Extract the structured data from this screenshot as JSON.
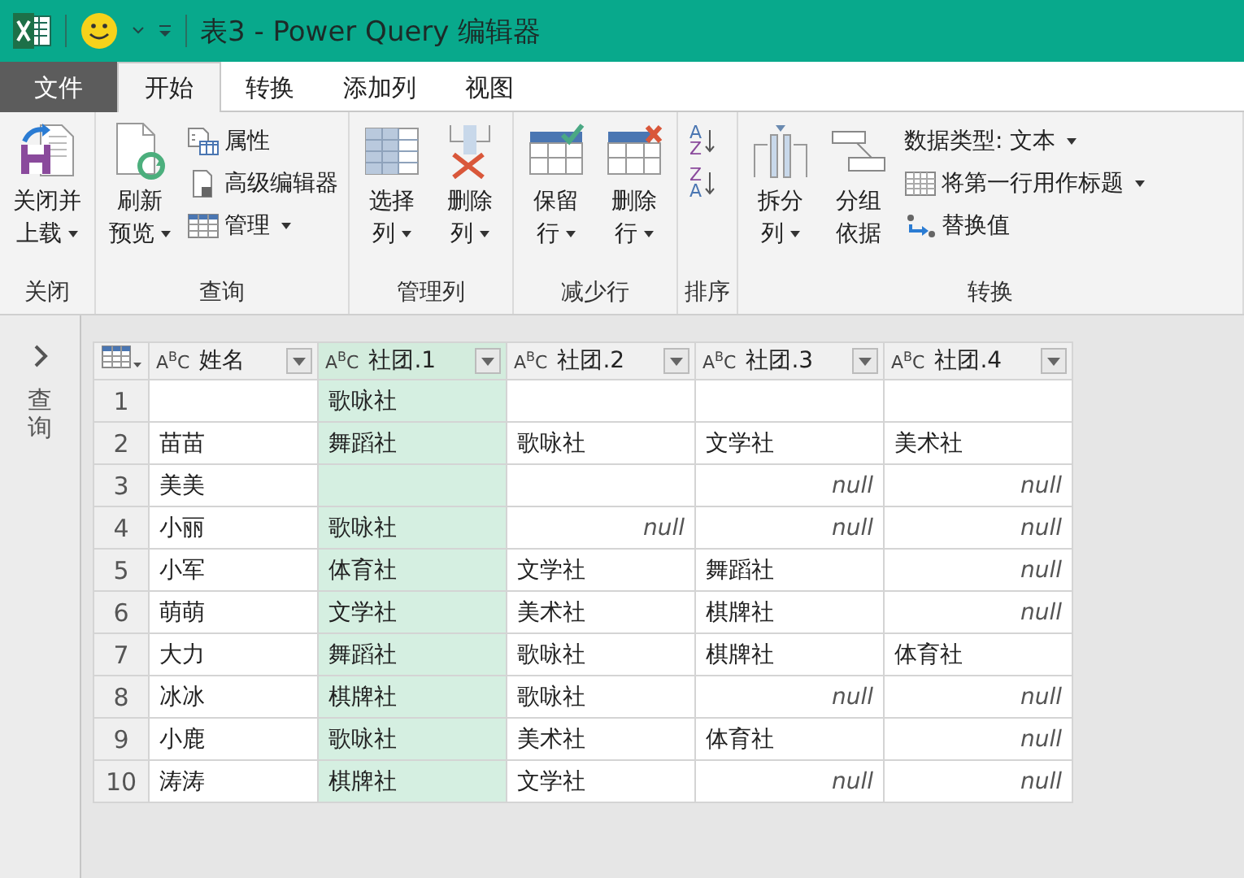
{
  "window": {
    "title": "表3 - Power Query 编辑器"
  },
  "tabs": [
    {
      "label": "文件",
      "kind": "file",
      "selected": false
    },
    {
      "label": "开始",
      "kind": "tab",
      "selected": true
    },
    {
      "label": "转换",
      "kind": "tab",
      "selected": false
    },
    {
      "label": "添加列",
      "kind": "tab",
      "selected": false
    },
    {
      "label": "视图",
      "kind": "tab",
      "selected": false
    }
  ],
  "ribbon": {
    "groups": [
      {
        "label": "关闭",
        "large_buttons": [
          {
            "lines": [
              "关闭并",
              "上载"
            ],
            "dropdown": true
          }
        ]
      },
      {
        "label": "查询",
        "large_buttons": [
          {
            "lines": [
              "刷新",
              "预览"
            ],
            "dropdown": true
          }
        ],
        "small_buttons": [
          {
            "label": "属性",
            "dropdown": false
          },
          {
            "label": "高级编辑器",
            "dropdown": false
          },
          {
            "label": "管理",
            "dropdown": true
          }
        ]
      },
      {
        "label": "管理列",
        "large_buttons": [
          {
            "lines": [
              "选择",
              "列"
            ],
            "dropdown": true
          },
          {
            "lines": [
              "删除",
              "列"
            ],
            "dropdown": true
          }
        ]
      },
      {
        "label": "减少行",
        "large_buttons": [
          {
            "lines": [
              "保留",
              "行"
            ],
            "dropdown": true
          },
          {
            "lines": [
              "删除",
              "行"
            ],
            "dropdown": true
          }
        ]
      },
      {
        "label": "排序",
        "sort_buttons": [
          {
            "top": "A",
            "bottom": "Z"
          },
          {
            "top": "Z",
            "bottom": "A"
          }
        ]
      },
      {
        "label": "转换",
        "large_buttons": [
          {
            "lines": [
              "拆分",
              "列"
            ],
            "dropdown": true
          },
          {
            "lines": [
              "分组",
              "依据"
            ],
            "dropdown": false
          }
        ],
        "small_buttons": [
          {
            "label": "数据类型: 文本",
            "dropdown": true
          },
          {
            "label": "将第一行用作标题",
            "dropdown": true
          },
          {
            "label": "替换值",
            "dropdown": false
          }
        ]
      }
    ]
  },
  "sidebar": {
    "label": "查询"
  },
  "table": {
    "columns": [
      {
        "type": "A$^{B}$C",
        "label": "姓名",
        "selected": false
      },
      {
        "type": "A$^{B}$C",
        "label": "社团.1",
        "selected": true
      },
      {
        "type": "A$^{B}$C",
        "label": "社团.2",
        "selected": false
      },
      {
        "type": "A$^{B}$C",
        "label": "社团.3",
        "selected": false
      },
      {
        "type": "A$^{B}$C",
        "label": "社团.4",
        "selected": false
      }
    ],
    "rows": [
      {
        "num": "1",
        "cells": [
          {},
          {
            "text": "歌咏社"
          },
          {},
          {},
          {}
        ]
      },
      {
        "num": "2",
        "cells": [
          {
            "text": "苗苗"
          },
          {
            "text": "舞蹈社"
          },
          {
            "text": "歌咏社"
          },
          {
            "text": "文学社"
          },
          {
            "text": "美术社"
          }
        ]
      },
      {
        "num": "3",
        "cells": [
          {
            "text": "美美"
          },
          {},
          {},
          {
            "text": "null",
            "null": true
          },
          {
            "text": "null",
            "null": true
          }
        ]
      },
      {
        "num": "4",
        "cells": [
          {
            "text": "小丽"
          },
          {
            "text": "歌咏社"
          },
          {
            "text": "null",
            "null": true
          },
          {
            "text": "null",
            "null": true
          },
          {
            "text": "null",
            "null": true
          }
        ]
      },
      {
        "num": "5",
        "cells": [
          {
            "text": "小军"
          },
          {
            "text": "体育社"
          },
          {
            "text": "文学社"
          },
          {
            "text": "舞蹈社"
          },
          {
            "text": "null",
            "null": true
          }
        ]
      },
      {
        "num": "6",
        "cells": [
          {
            "text": "萌萌"
          },
          {
            "text": "文学社"
          },
          {
            "text": "美术社"
          },
          {
            "text": "棋牌社"
          },
          {
            "text": "null",
            "null": true
          }
        ]
      },
      {
        "num": "7",
        "cells": [
          {
            "text": "大力"
          },
          {
            "text": "舞蹈社"
          },
          {
            "text": "歌咏社"
          },
          {
            "text": "棋牌社"
          },
          {
            "text": "体育社"
          }
        ]
      },
      {
        "num": "8",
        "cells": [
          {
            "text": "冰冰"
          },
          {
            "text": "棋牌社"
          },
          {
            "text": "歌咏社"
          },
          {
            "text": "null",
            "null": true
          },
          {
            "text": "null",
            "null": true
          }
        ]
      },
      {
        "num": "9",
        "cells": [
          {
            "text": "小鹿"
          },
          {
            "text": "歌咏社"
          },
          {
            "text": "美术社"
          },
          {
            "text": "体育社"
          },
          {
            "text": "null",
            "null": true
          }
        ]
      },
      {
        "num": "10",
        "cells": [
          {
            "text": "涛涛"
          },
          {
            "text": "棋牌社"
          },
          {
            "text": "文学社"
          },
          {
            "text": "null",
            "null": true
          },
          {
            "text": "null",
            "null": true
          }
        ]
      }
    ]
  }
}
